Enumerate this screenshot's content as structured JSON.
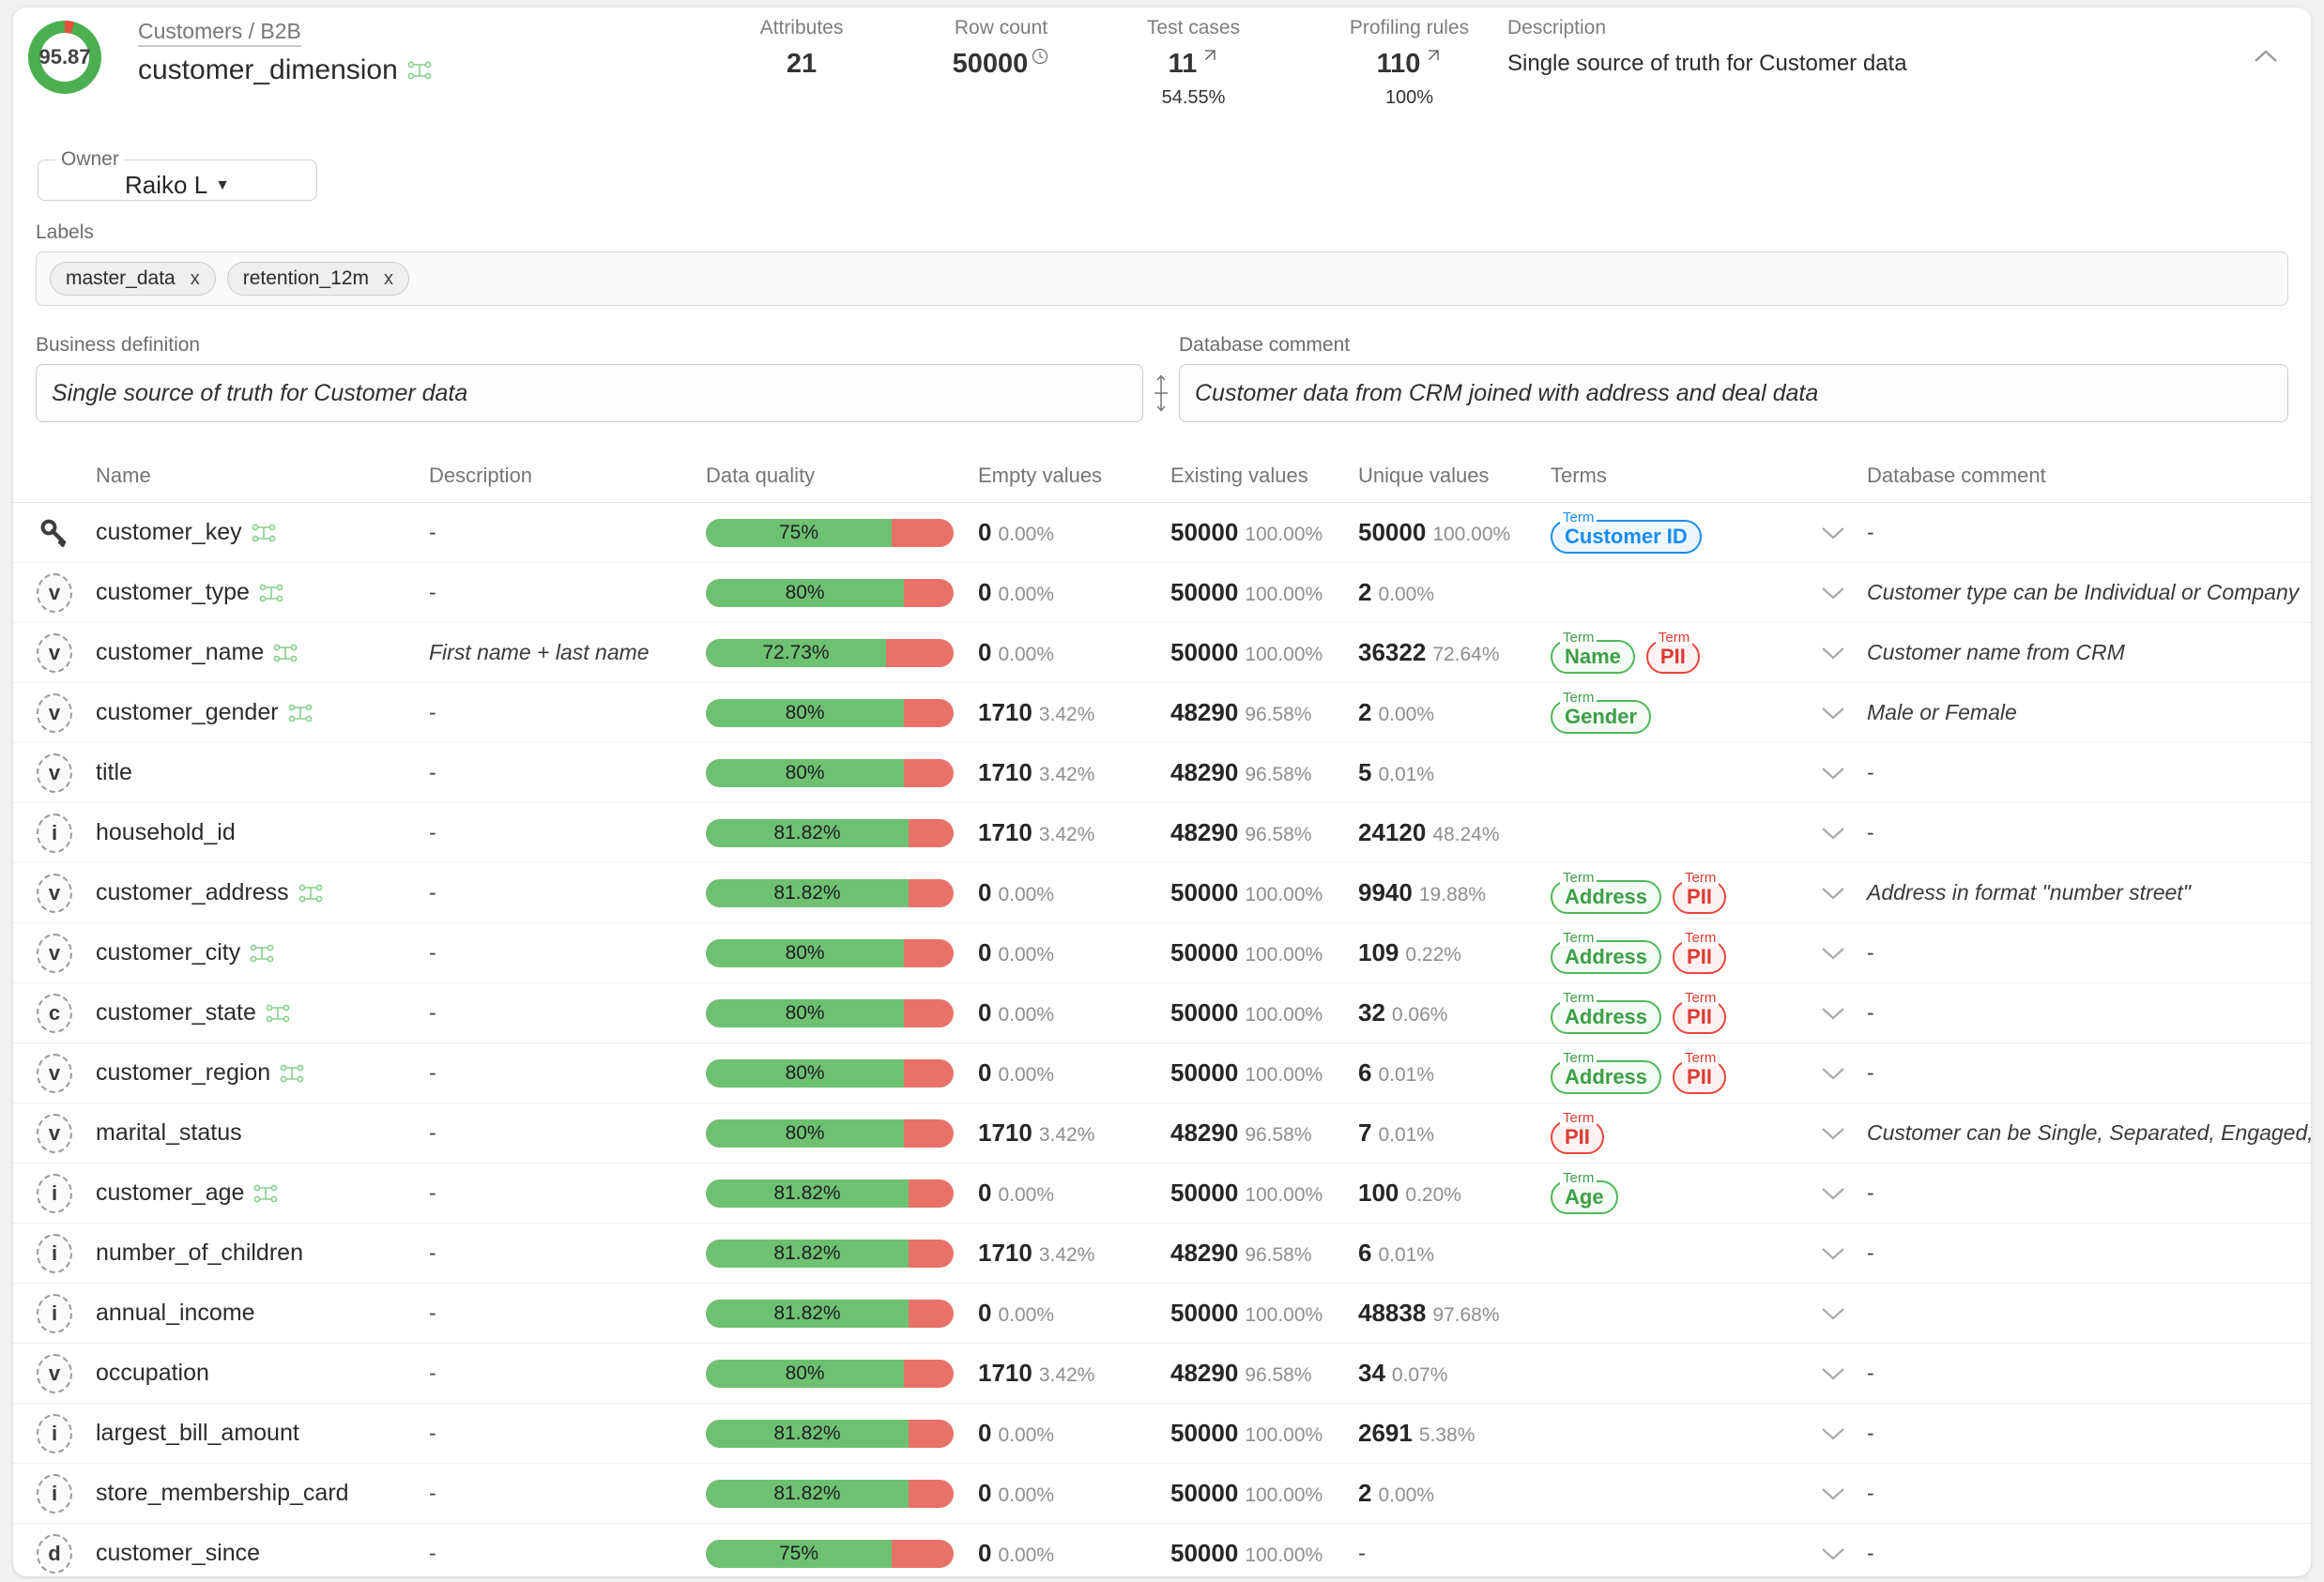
{
  "header": {
    "score": "95.87",
    "breadcrumb": "Customers / B2B",
    "title": "customer_dimension",
    "stats": [
      {
        "label": "Attributes",
        "value": "21",
        "sub": "",
        "icon": ""
      },
      {
        "label": "Row count",
        "value": "50000",
        "sub": "",
        "icon": "clock-icon"
      },
      {
        "label": "Test cases",
        "value": "11",
        "sub": "54.55%",
        "icon": "external-link-icon"
      },
      {
        "label": "Profiling rules",
        "value": "110",
        "sub": "100%",
        "icon": "external-link-icon"
      }
    ],
    "description_label": "Description",
    "description_value": "Single source of truth for Customer data"
  },
  "owner": {
    "label": "Owner",
    "value": "Raiko L"
  },
  "labels": {
    "title": "Labels",
    "chips": [
      {
        "text": "master_data",
        "remove": "x"
      },
      {
        "text": "retention_12m",
        "remove": "x"
      }
    ]
  },
  "definitions": {
    "business_label": "Business definition",
    "business_value": "Single source of truth for Customer data",
    "db_label": "Database comment",
    "db_value": "Customer data from CRM joined with address and deal data"
  },
  "table": {
    "columns": [
      "Name",
      "Description",
      "Data quality",
      "Empty values",
      "Existing values",
      "Unique values",
      "Terms",
      "Database comment"
    ],
    "rows": [
      {
        "icon": "key",
        "lineage": true,
        "name": "customer_key",
        "desc": "-",
        "dq": "75%",
        "dq_pct": 75,
        "empty": "0",
        "empty_pct": "0.00%",
        "exist": "50000",
        "exist_pct": "100.00%",
        "uniq": "50000",
        "uniq_pct": "100.00%",
        "terms": [
          {
            "text": "Customer ID",
            "color": "blue",
            "legend": "Term"
          }
        ],
        "comment": "-"
      },
      {
        "icon": "v",
        "lineage": true,
        "name": "customer_type",
        "desc": "-",
        "dq": "80%",
        "dq_pct": 80,
        "empty": "0",
        "empty_pct": "0.00%",
        "exist": "50000",
        "exist_pct": "100.00%",
        "uniq": "2",
        "uniq_pct": "0.00%",
        "terms": [],
        "comment": "Customer type can be Individual or Company"
      },
      {
        "icon": "v",
        "lineage": true,
        "name": "customer_name",
        "desc": "First name + last name",
        "dq": "72.73%",
        "dq_pct": 72.73,
        "empty": "0",
        "empty_pct": "0.00%",
        "exist": "50000",
        "exist_pct": "100.00%",
        "uniq": "36322",
        "uniq_pct": "72.64%",
        "terms": [
          {
            "text": "Name",
            "color": "green",
            "legend": "Term"
          },
          {
            "text": "PII",
            "color": "red",
            "legend": "Term"
          }
        ],
        "comment": "Customer name from CRM"
      },
      {
        "icon": "v",
        "lineage": true,
        "name": "customer_gender",
        "desc": "-",
        "dq": "80%",
        "dq_pct": 80,
        "empty": "1710",
        "empty_pct": "3.42%",
        "exist": "48290",
        "exist_pct": "96.58%",
        "uniq": "2",
        "uniq_pct": "0.00%",
        "terms": [
          {
            "text": "Gender",
            "color": "green",
            "legend": "Term"
          }
        ],
        "comment": "Male or Female"
      },
      {
        "icon": "v",
        "lineage": false,
        "name": "title",
        "desc": "-",
        "dq": "80%",
        "dq_pct": 80,
        "empty": "1710",
        "empty_pct": "3.42%",
        "exist": "48290",
        "exist_pct": "96.58%",
        "uniq": "5",
        "uniq_pct": "0.01%",
        "terms": [],
        "comment": "-"
      },
      {
        "icon": "i",
        "lineage": false,
        "name": "household_id",
        "desc": "-",
        "dq": "81.82%",
        "dq_pct": 81.82,
        "empty": "1710",
        "empty_pct": "3.42%",
        "exist": "48290",
        "exist_pct": "96.58%",
        "uniq": "24120",
        "uniq_pct": "48.24%",
        "terms": [],
        "comment": "-"
      },
      {
        "icon": "v",
        "lineage": true,
        "name": "customer_address",
        "desc": "-",
        "dq": "81.82%",
        "dq_pct": 81.82,
        "empty": "0",
        "empty_pct": "0.00%",
        "exist": "50000",
        "exist_pct": "100.00%",
        "uniq": "9940",
        "uniq_pct": "19.88%",
        "terms": [
          {
            "text": "Address",
            "color": "green",
            "legend": "Term"
          },
          {
            "text": "PII",
            "color": "red",
            "legend": "Term"
          }
        ],
        "comment": "Address in format \"number street\""
      },
      {
        "icon": "v",
        "lineage": true,
        "name": "customer_city",
        "desc": "-",
        "dq": "80%",
        "dq_pct": 80,
        "empty": "0",
        "empty_pct": "0.00%",
        "exist": "50000",
        "exist_pct": "100.00%",
        "uniq": "109",
        "uniq_pct": "0.22%",
        "terms": [
          {
            "text": "Address",
            "color": "green",
            "legend": "Term"
          },
          {
            "text": "PII",
            "color": "red",
            "legend": "Term"
          }
        ],
        "comment": "-"
      },
      {
        "icon": "c",
        "lineage": true,
        "name": "customer_state",
        "desc": "-",
        "dq": "80%",
        "dq_pct": 80,
        "empty": "0",
        "empty_pct": "0.00%",
        "exist": "50000",
        "exist_pct": "100.00%",
        "uniq": "32",
        "uniq_pct": "0.06%",
        "terms": [
          {
            "text": "Address",
            "color": "green",
            "legend": "Term"
          },
          {
            "text": "PII",
            "color": "red",
            "legend": "Term"
          }
        ],
        "comment": "-"
      },
      {
        "icon": "v",
        "lineage": true,
        "name": "customer_region",
        "desc": "-",
        "dq": "80%",
        "dq_pct": 80,
        "empty": "0",
        "empty_pct": "0.00%",
        "exist": "50000",
        "exist_pct": "100.00%",
        "uniq": "6",
        "uniq_pct": "0.01%",
        "terms": [
          {
            "text": "Address",
            "color": "green",
            "legend": "Term"
          },
          {
            "text": "PII",
            "color": "red",
            "legend": "Term"
          }
        ],
        "comment": "-"
      },
      {
        "icon": "v",
        "lineage": false,
        "name": "marital_status",
        "desc": "-",
        "dq": "80%",
        "dq_pct": 80,
        "empty": "1710",
        "empty_pct": "3.42%",
        "exist": "48290",
        "exist_pct": "96.58%",
        "uniq": "7",
        "uniq_pct": "0.01%",
        "terms": [
          {
            "text": "PII",
            "color": "red",
            "legend": "Term"
          }
        ],
        "comment": "Customer can be Single, Separated, Engaged, Marri"
      },
      {
        "icon": "i",
        "lineage": true,
        "name": "customer_age",
        "desc": "-",
        "dq": "81.82%",
        "dq_pct": 81.82,
        "empty": "0",
        "empty_pct": "0.00%",
        "exist": "50000",
        "exist_pct": "100.00%",
        "uniq": "100",
        "uniq_pct": "0.20%",
        "terms": [
          {
            "text": "Age",
            "color": "green",
            "legend": "Term"
          }
        ],
        "comment": "-"
      },
      {
        "icon": "i",
        "lineage": false,
        "name": "number_of_children",
        "desc": "-",
        "dq": "81.82%",
        "dq_pct": 81.82,
        "empty": "1710",
        "empty_pct": "3.42%",
        "exist": "48290",
        "exist_pct": "96.58%",
        "uniq": "6",
        "uniq_pct": "0.01%",
        "terms": [],
        "comment": "-"
      },
      {
        "icon": "i",
        "lineage": false,
        "name": "annual_income",
        "desc": "-",
        "dq": "81.82%",
        "dq_pct": 81.82,
        "empty": "0",
        "empty_pct": "0.00%",
        "exist": "50000",
        "exist_pct": "100.00%",
        "uniq": "48838",
        "uniq_pct": "97.68%",
        "terms": [],
        "comment": ""
      },
      {
        "icon": "v",
        "lineage": false,
        "name": "occupation",
        "desc": "-",
        "dq": "80%",
        "dq_pct": 80,
        "empty": "1710",
        "empty_pct": "3.42%",
        "exist": "48290",
        "exist_pct": "96.58%",
        "uniq": "34",
        "uniq_pct": "0.07%",
        "terms": [],
        "comment": "-"
      },
      {
        "icon": "i",
        "lineage": false,
        "name": "largest_bill_amount",
        "desc": "-",
        "dq": "81.82%",
        "dq_pct": 81.82,
        "empty": "0",
        "empty_pct": "0.00%",
        "exist": "50000",
        "exist_pct": "100.00%",
        "uniq": "2691",
        "uniq_pct": "5.38%",
        "terms": [],
        "comment": "-"
      },
      {
        "icon": "i",
        "lineage": false,
        "name": "store_membership_card",
        "desc": "-",
        "dq": "81.82%",
        "dq_pct": 81.82,
        "empty": "0",
        "empty_pct": "0.00%",
        "exist": "50000",
        "exist_pct": "100.00%",
        "uniq": "2",
        "uniq_pct": "0.00%",
        "terms": [],
        "comment": "-"
      },
      {
        "icon": "d",
        "lineage": false,
        "name": "customer_since",
        "desc": "-",
        "dq": "75%",
        "dq_pct": 75,
        "empty": "0",
        "empty_pct": "0.00%",
        "exist": "50000",
        "exist_pct": "100.00%",
        "uniq": "-",
        "uniq_pct": "",
        "terms": [],
        "comment": "-"
      }
    ]
  },
  "colors": {
    "good": "#6ec173",
    "bad": "#e8726a",
    "term_green": "#51b75a",
    "term_red": "#e8453c",
    "term_blue": "#1a8cf0"
  }
}
